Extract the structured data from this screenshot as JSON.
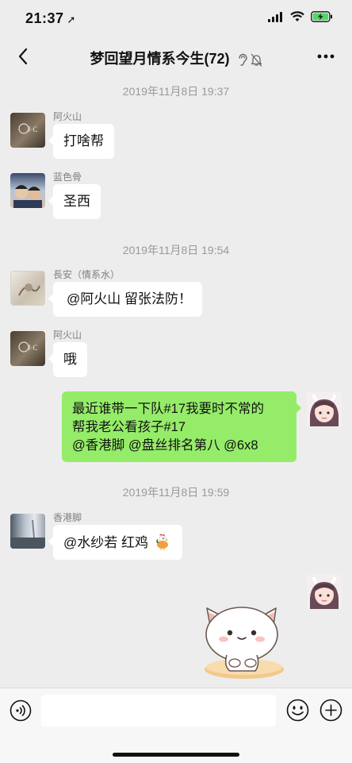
{
  "status": {
    "time": "21:37",
    "location_icon": "location-arrow-icon",
    "battery_color": "#4cd964"
  },
  "nav": {
    "title": "梦回望月情系今生(72)",
    "back_icon": "chevron-left-icon",
    "more_icon": "more-dots-icon"
  },
  "chat": {
    "timestamps": [
      "2019年11月8日 19:37",
      "2019年11月8日 19:54",
      "2019年11月8日 19:59"
    ],
    "messages": [
      {
        "sender": "阿火山",
        "text": "打啥帮"
      },
      {
        "sender": "蓝色骨",
        "text": "圣西"
      },
      {
        "sender": "長安（情系水）",
        "text": "@阿火山 留张法防！"
      },
      {
        "sender": "阿火山",
        "text": "哦"
      },
      {
        "sender": "",
        "lines": [
          "最近谁带一下队#17我要时不常的",
          "帮我老公看孩子#17",
          "@香港脚 @盘丝排名第八 @6x8"
        ]
      },
      {
        "sender": "香港脚",
        "text": "@水纱若 红鸡"
      }
    ],
    "avatar_jc_text": "J·C"
  },
  "input": {
    "placeholder": ""
  },
  "colors": {
    "background": "#ededed",
    "bubble_self": "#95ec69",
    "bubble_other": "#ffffff"
  }
}
